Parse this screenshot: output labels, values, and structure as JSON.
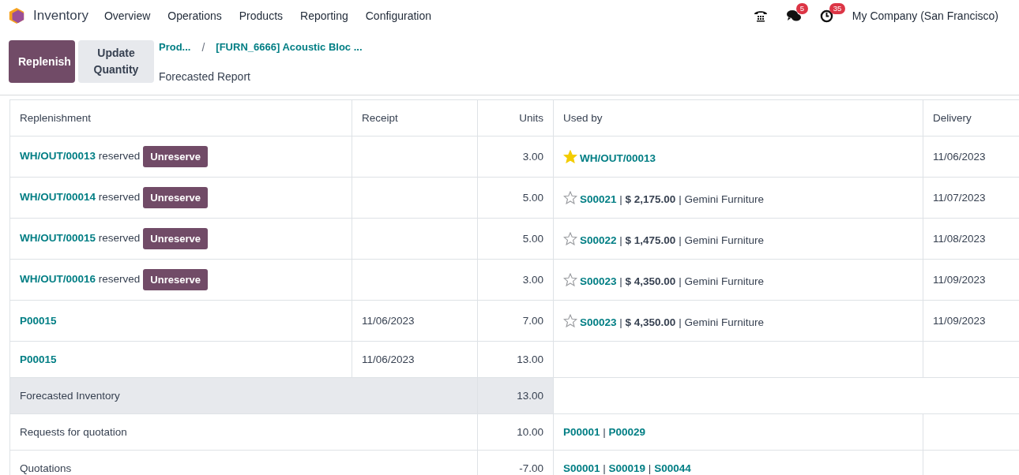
{
  "navbar": {
    "app": "Inventory",
    "menu": [
      "Overview",
      "Operations",
      "Products",
      "Reporting",
      "Configuration"
    ],
    "messages_count": "5",
    "activities_count": "35",
    "company": "My Company (San Francisco)"
  },
  "control_panel": {
    "buttons": [
      {
        "label": "Replenish",
        "kind": "primary"
      },
      {
        "label": "Update Quantity",
        "kind": "secondary"
      }
    ],
    "breadcrumbs": [
      "Prod...",
      "[FURN_6666] Acoustic Bloc ..."
    ],
    "breadcrumb_separator": "/",
    "title": "Forecasted Report"
  },
  "table": {
    "columns": [
      "Replenishment",
      "Receipt",
      "Units",
      "Used by",
      "Delivery"
    ],
    "separator": "|",
    "moves": [
      {
        "reference": "WH/OUT/00013",
        "note": "reserved",
        "action": "Unreserve",
        "units": "3.00",
        "used_by": {
          "starred": true,
          "reference": "WH/OUT/00013"
        },
        "delivery": "11/06/2023"
      },
      {
        "reference": "WH/OUT/00014",
        "note": "reserved",
        "action": "Unreserve",
        "units": "5.00",
        "used_by": {
          "starred": false,
          "reference": "S00021",
          "amount": "$ 2,175.00",
          "partner": "Gemini Furniture"
        },
        "delivery": "11/07/2023"
      },
      {
        "reference": "WH/OUT/00015",
        "note": "reserved",
        "action": "Unreserve",
        "units": "5.00",
        "used_by": {
          "starred": false,
          "reference": "S00022",
          "amount": "$ 1,475.00",
          "partner": "Gemini Furniture"
        },
        "delivery": "11/08/2023"
      },
      {
        "reference": "WH/OUT/00016",
        "note": "reserved",
        "action": "Unreserve",
        "units": "3.00",
        "used_by": {
          "starred": false,
          "reference": "S00023",
          "amount": "$ 4,350.00",
          "partner": "Gemini Furniture"
        },
        "delivery": "11/09/2023"
      },
      {
        "reference": "P00015",
        "receipt": "11/06/2023",
        "units": "7.00",
        "used_by": {
          "starred": false,
          "reference": "S00023",
          "amount": "$ 4,350.00",
          "partner": "Gemini Furniture"
        },
        "delivery": "11/09/2023"
      },
      {
        "reference": "P00015",
        "receipt": "11/06/2023",
        "units": "13.00"
      }
    ],
    "summary": [
      {
        "kind": "total",
        "label": "Forecasted Inventory",
        "units": "13.00"
      },
      {
        "kind": "pending",
        "label": "Requests for quotation",
        "units": "10.00",
        "references": [
          "P00001",
          "P00029"
        ]
      },
      {
        "kind": "pending",
        "label": "Quotations",
        "units": "-7.00",
        "references": [
          "S00001",
          "S00019",
          "S00044"
        ]
      }
    ]
  }
}
